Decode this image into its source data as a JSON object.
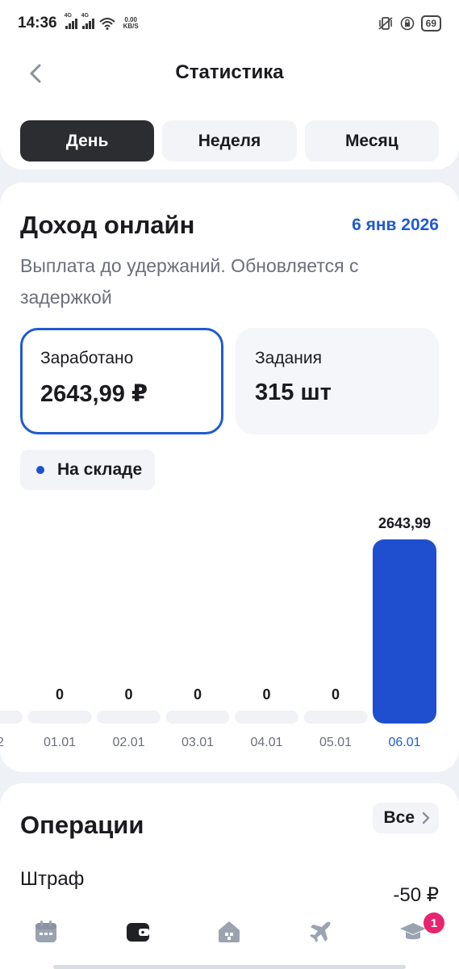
{
  "status_bar": {
    "time": "14:36",
    "network_1": "4G",
    "network_2": "4G",
    "speed_value": "0.00",
    "speed_unit": "KB/S",
    "battery": "69"
  },
  "header": {
    "title": "Статистика",
    "back_icon": "chevron-left-icon"
  },
  "period_tabs": [
    {
      "label": "День",
      "active": true
    },
    {
      "label": "Неделя",
      "active": false
    },
    {
      "label": "Месяц",
      "active": false
    }
  ],
  "income": {
    "title": "Доход онлайн",
    "date": "6 янв 2026",
    "note": "Выплата до удержаний. Обновляется с задержкой",
    "earned_label": "Заработано",
    "earned_value": "2643,99 ₽",
    "tasks_label": "Задания",
    "tasks_value": "315 шт",
    "legend_label": "На складе"
  },
  "chart_data": {
    "type": "bar",
    "categories": [
      "01.01",
      "02.01",
      "03.01",
      "04.01",
      "05.01",
      "06.01"
    ],
    "values": [
      0,
      0,
      0,
      0,
      0,
      2643.99
    ],
    "value_labels": [
      "0",
      "0",
      "0",
      "0",
      "0",
      "2643,99"
    ],
    "partial_left_label": "2",
    "selected_category": "06.01",
    "bar_color": "#1f4fcf",
    "empty_bar_color": "#f0f2f6",
    "selected_label_color": "#1f5bd1",
    "label_color": "#6b6f7a"
  },
  "operations": {
    "title": "Операции",
    "all_label": "Все",
    "items": [
      {
        "name": "Штраф",
        "amount": "-50 ₽"
      }
    ]
  },
  "bottom_nav": {
    "items": [
      {
        "icon": "calendar-icon"
      },
      {
        "icon": "wallet-icon",
        "active": true
      },
      {
        "icon": "warehouse-icon"
      },
      {
        "icon": "airplane-icon"
      },
      {
        "icon": "graduation-cap-icon",
        "badge": "1"
      }
    ]
  },
  "colors": {
    "accent": "#1f5bd1",
    "active_tab": "#2c2d31",
    "badge": "#e8246e"
  }
}
